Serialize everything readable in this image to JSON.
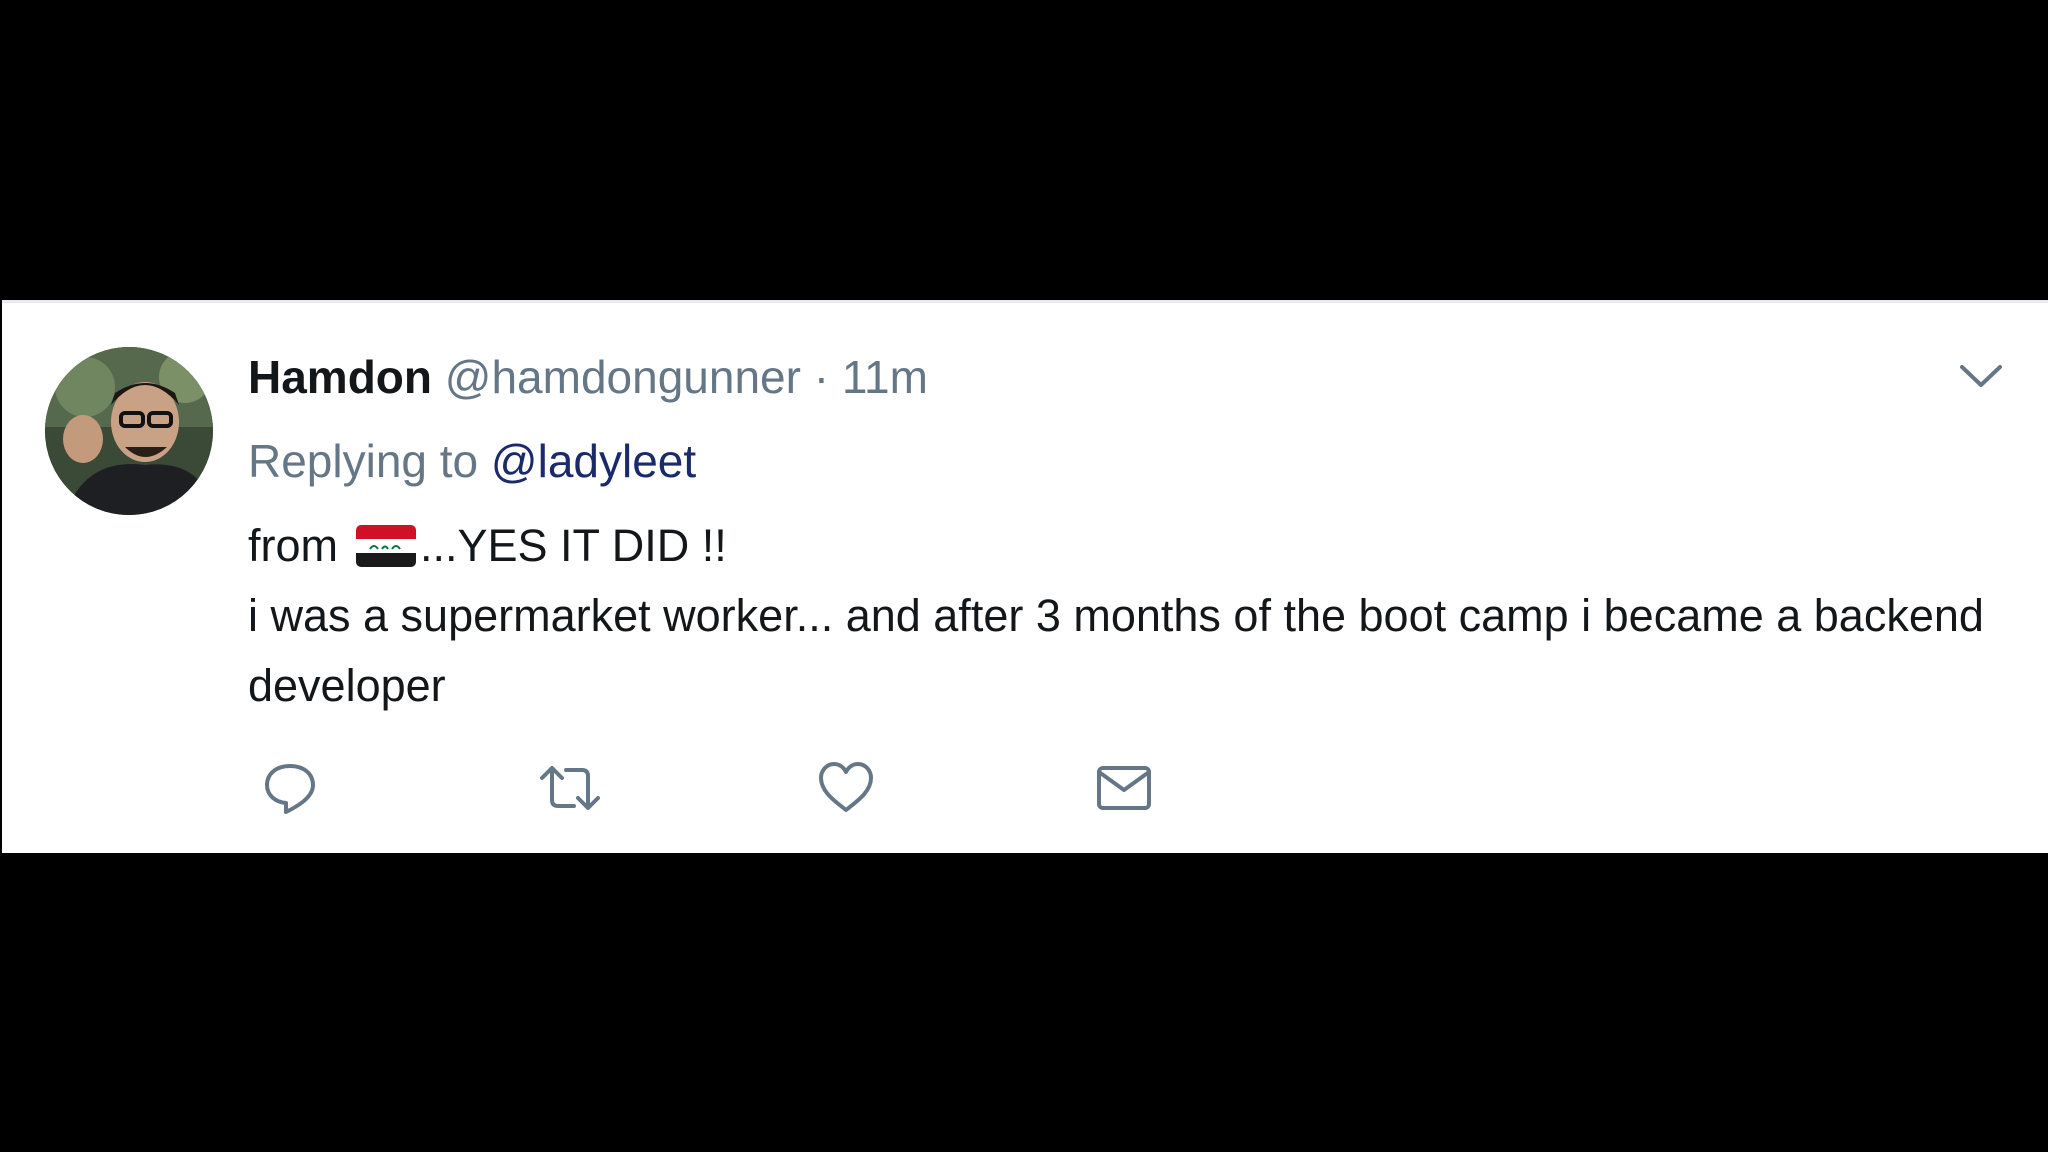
{
  "tweet": {
    "display_name": "Hamdon",
    "handle": "@hamdongunner",
    "separator": "·",
    "timestamp": "11m",
    "replying_prefix": "Replying to",
    "replying_to": "@ladyleet",
    "body_prefix": "from",
    "flag_emoji": "iraq-flag-emoji",
    "body_line1_suffix": "...YES IT DID !!",
    "body_line2": "i was a supermarket worker... and after 3 months of the boot camp i became a backend developer",
    "avatar_icon": "user-avatar",
    "menu_icon": "chevron-down-icon"
  },
  "actions": [
    {
      "icon": "reply-icon"
    },
    {
      "icon": "retweet-icon"
    },
    {
      "icon": "like-icon"
    },
    {
      "icon": "direct-message-icon"
    }
  ],
  "colors": {
    "name_text": "#14171a",
    "secondary_text": "#657786",
    "mention_link": "#1b2a6b",
    "icon_stroke": "#657786",
    "card_background": "#ffffff",
    "page_background": "#000000"
  }
}
